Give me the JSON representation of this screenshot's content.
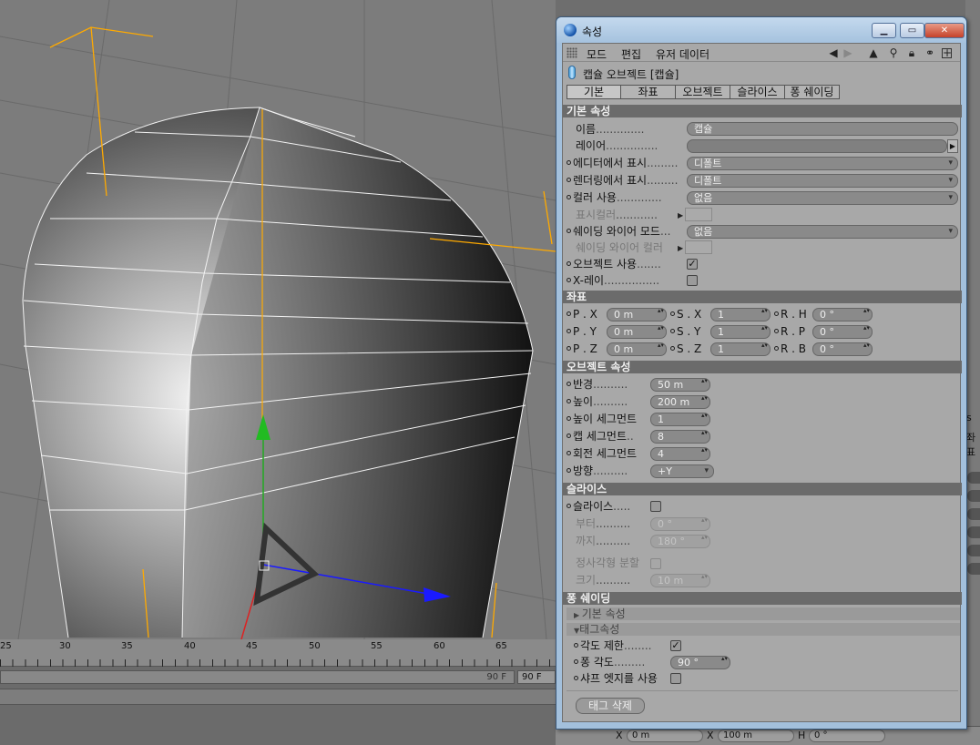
{
  "window": {
    "title": "속성"
  },
  "menu": {
    "items": [
      "모드",
      "편집",
      "유저 데이터"
    ]
  },
  "object": {
    "title": "캡슐 오브젝트 [캡슐]"
  },
  "tabs": [
    "기본",
    "좌표",
    "오브젝트",
    "슬라이스",
    "퐁 쉐이딩"
  ],
  "basic": {
    "header": "기본 속성",
    "name_label": "이름",
    "name_value": "캡슐",
    "layer_label": "레이어",
    "editor_label": "에디터에서 표시",
    "editor_value": "디폴트",
    "render_label": "렌더링에서 표시",
    "render_value": "디폴트",
    "color_label": "컬러 사용",
    "color_value": "없음",
    "display_color_label": "표시컬러",
    "wire_mode_label": "쉐이딩 와이어 모드",
    "wire_mode_value": "없음",
    "wire_color_label": "쉐이딩 와이어 컬러",
    "enable_label": "오브젝트 사용",
    "enable_checked": "✓",
    "xray_label": "X-레이"
  },
  "coords": {
    "header": "좌표",
    "rows": [
      {
        "p_label": "P . X",
        "p_value": "0 m",
        "s_label": "S . X",
        "s_value": "1",
        "r_label": "R . H",
        "r_value": "0 °"
      },
      {
        "p_label": "P . Y",
        "p_value": "0 m",
        "s_label": "S . Y",
        "s_value": "1",
        "r_label": "R . P",
        "r_value": "0 °"
      },
      {
        "p_label": "P . Z",
        "p_value": "0 m",
        "s_label": "S . Z",
        "s_value": "1",
        "r_label": "R . B",
        "r_value": "0 °"
      }
    ]
  },
  "objprops": {
    "header": "오브젝트 속성",
    "radius_label": "반경",
    "radius_value": "50 m",
    "height_label": "높이",
    "height_value": "200 m",
    "hseg_label": "높이 세그먼트",
    "hseg_value": "1",
    "capseg_label": "캡 세그먼트",
    "capseg_value": "8",
    "rotseg_label": "회전 세그먼트",
    "rotseg_value": "4",
    "orient_label": "방향",
    "orient_value": "+Y"
  },
  "slice": {
    "header": "슬라이스",
    "slice_label": "슬라이스",
    "from_label": "부터",
    "from_value": "0 °",
    "to_label": "까지",
    "to_value": "180 °",
    "regular_label": "정사각형 분할",
    "size_label": "크기",
    "size_value": "10 m"
  },
  "phong": {
    "header": "퐁 쉐이딩",
    "basic_sub": "기본 속성",
    "tag_sub": "태그속성",
    "angle_limit_label": "각도 제한",
    "angle_limit_checked": "✓",
    "phong_angle_label": "퐁 각도",
    "phong_angle_value": "90 °",
    "edge_break_label": "샤프 엣지를 사용",
    "delete_tag_button": "태그 삭제"
  },
  "timeline": {
    "ticks": [
      "25",
      "30",
      "35",
      "40",
      "45",
      "50",
      "55",
      "60",
      "65"
    ],
    "end_frame_inner": "90 F",
    "end_frame": "90 F"
  },
  "bottom_coords": {
    "x_label": "X",
    "x_value": "0 m",
    "x2_label": "X",
    "x2_value": "100 m",
    "h_label": "H",
    "h_value": "0 °"
  },
  "bg_fragments": {
    "a": "s",
    "b": "좌표"
  },
  "colors": {
    "section": "#6b6b6b",
    "panel": "#a8a8a8",
    "title_bar": "#a5c2de",
    "close_button": "#c5412a",
    "axis_y": "#22aa22",
    "axis_x": "#1a1aff",
    "axis_z": "#dd2222",
    "selection": "#ffaa00"
  }
}
